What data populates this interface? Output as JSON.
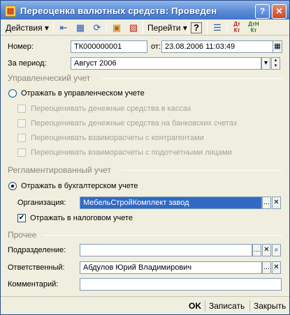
{
  "window": {
    "title": "Переоценка валютных средств: Проведен",
    "help_glyph": "?",
    "close_glyph": "✕"
  },
  "toolbar": {
    "actions_label": "Действия",
    "goto_label": "Перейти",
    "icons": [
      "arrow-left-icon",
      "document-structure-icon",
      "refresh-icon",
      "post-document-icon",
      "unpost-document-icon",
      "help-icon",
      "list-settings-icon",
      "dt-kt-icon",
      "dt-kt-n-icon"
    ]
  },
  "form": {
    "number_label": "Номер:",
    "number_value": "ТК000000001",
    "from_label": "от:",
    "date_value": "23.08.2006 11:03:49",
    "period_label": "За период:",
    "period_value": "Август 2006"
  },
  "mgmt": {
    "section_title": "Управленческий учет",
    "reflect_label": "Отражать в управленческом учете",
    "reflect_selected": false,
    "options": [
      "Переоценивать денежные средства в кассах",
      "Переоценивать денежные средства на банковских счетах",
      "Переоценивать взаиморасчеты с контрагентами",
      "Переоценивать взаиморасчеты с подотчетными лицами"
    ]
  },
  "regulated": {
    "section_title": "Регламентированный учет",
    "reflect_label": "Отражать в бухгалтерском учете",
    "reflect_selected": true,
    "org_label": "Организация:",
    "org_value": "МебельСтройКомплект завод",
    "tax_label": "Отражать в налоговом учете",
    "tax_checked": true
  },
  "other": {
    "section_title": "Прочее",
    "division_label": "Подразделение:",
    "division_value": "",
    "responsible_label": "Ответственный:",
    "responsible_value": "Абдулов Юрий Владимирович",
    "comment_label": "Комментарий:",
    "comment_value": ""
  },
  "bottom": {
    "ok_label": "OK",
    "save_label": "Записать",
    "close_label": "Закрыть"
  }
}
